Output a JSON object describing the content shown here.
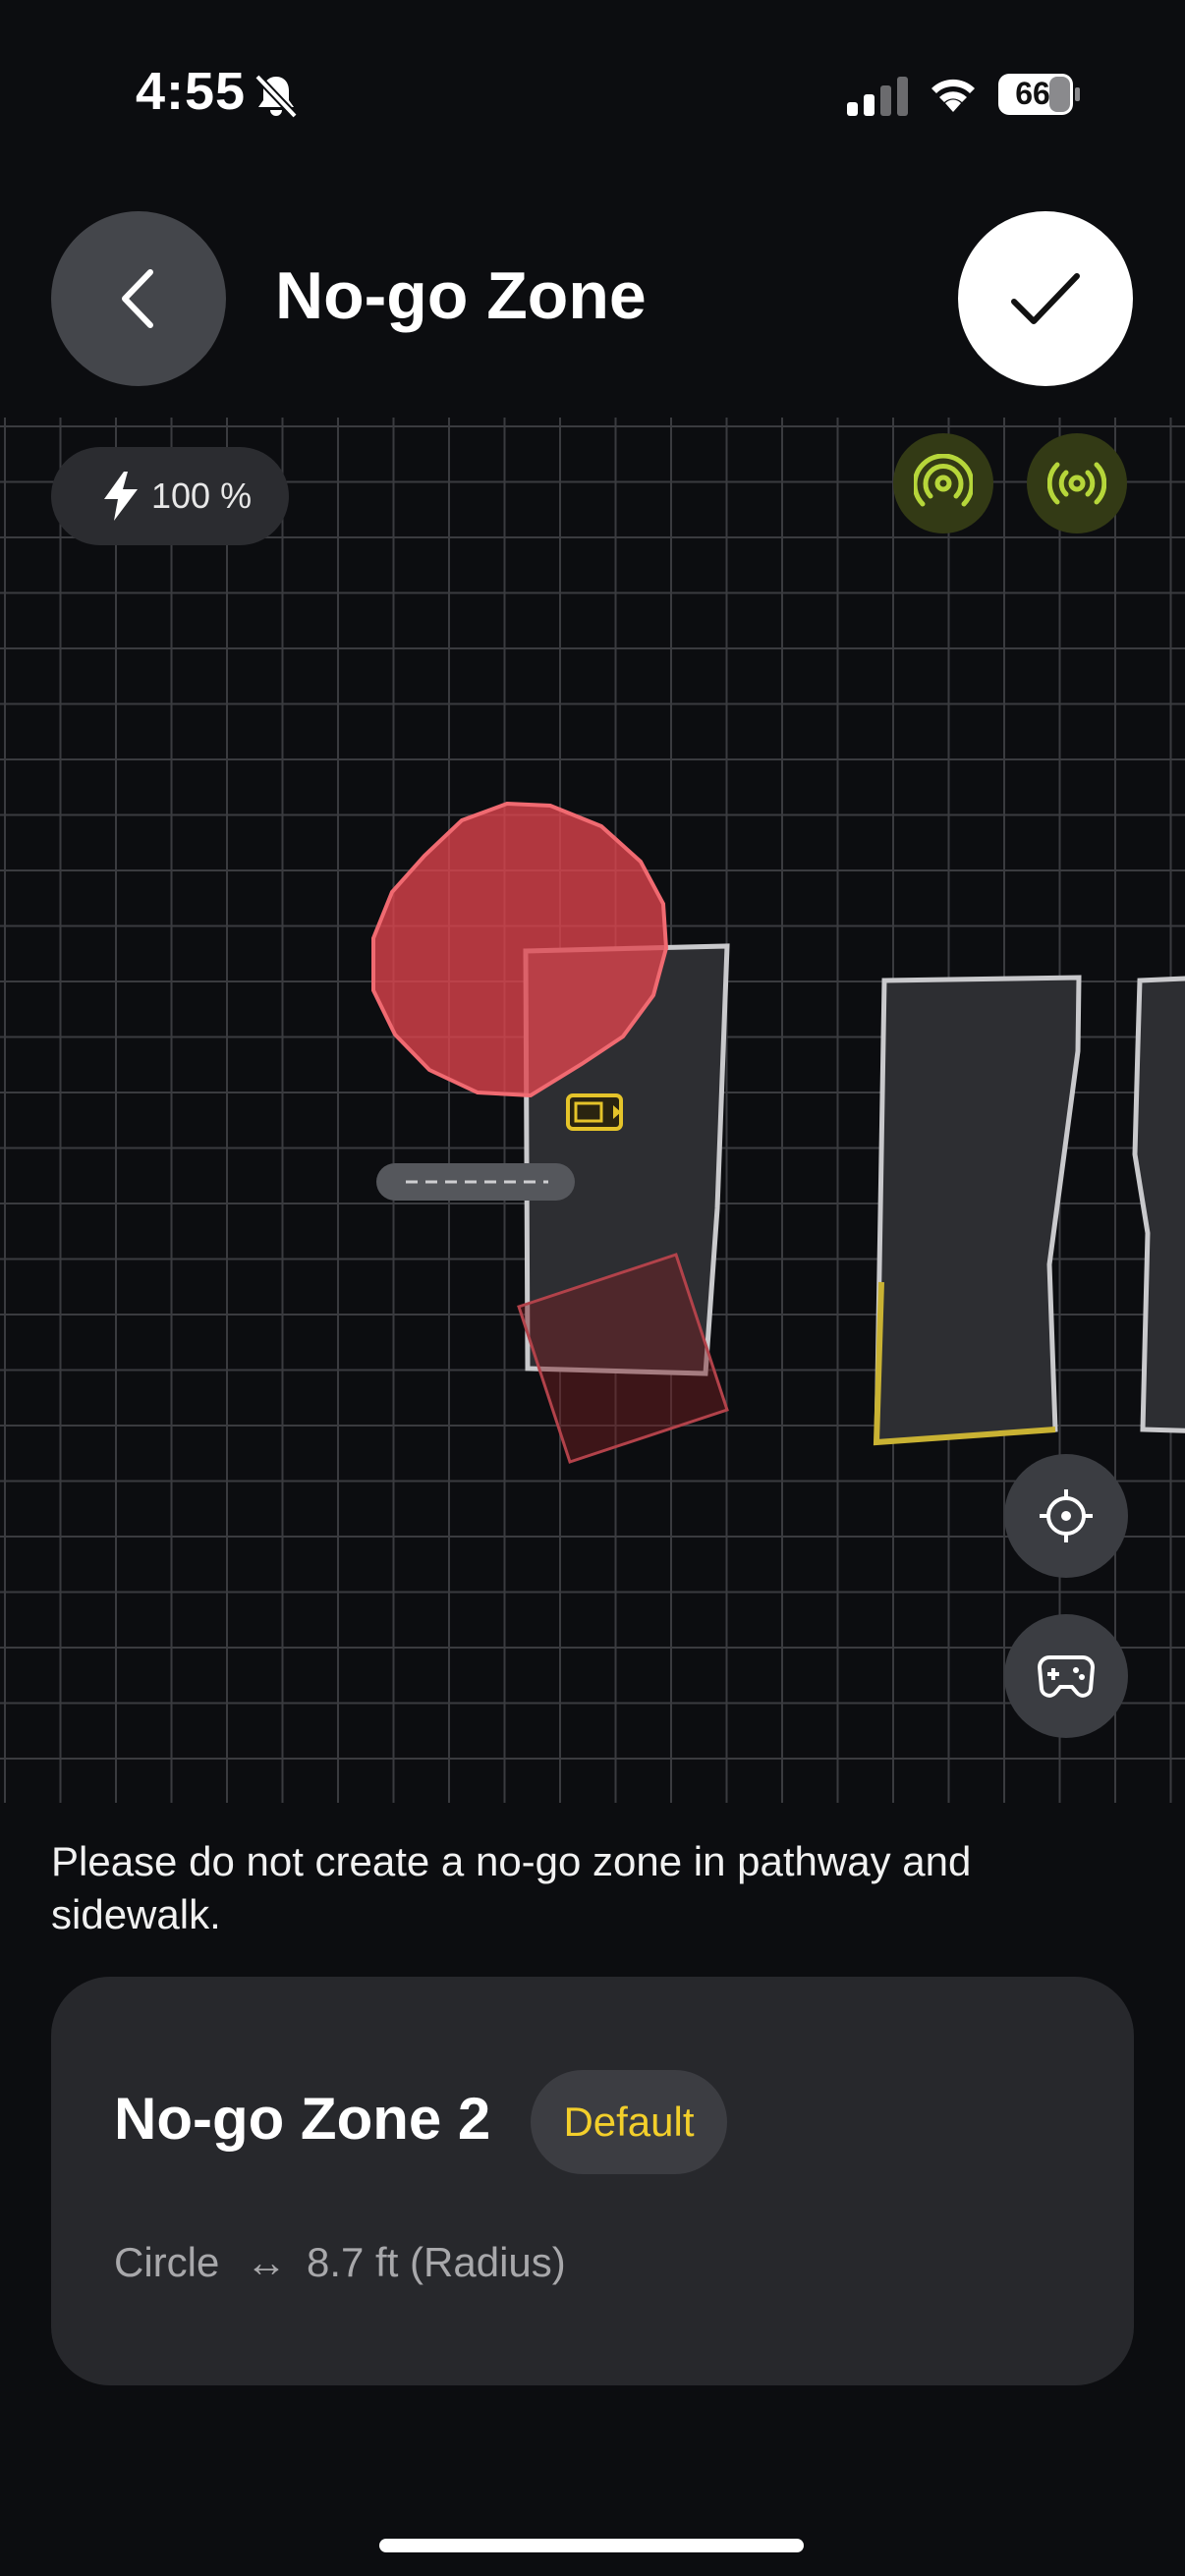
{
  "status_bar": {
    "time": "4:55",
    "battery": "66"
  },
  "header": {
    "title": "No-go Zone"
  },
  "map": {
    "battery_label": "100 %",
    "zone_colors": {
      "no_go_fill": "#e0444d",
      "boundary": "#c9c9cc",
      "edge_highlight": "#c9b233",
      "marker": "#e5c42a"
    }
  },
  "info": {
    "warning": "Please do not create a no-go zone in pathway and sidewalk."
  },
  "zone_card": {
    "name": "No-go Zone 2",
    "badge": "Default",
    "shape": "Circle",
    "arrow": "↔",
    "radius": "8.7 ft (Radius)"
  }
}
